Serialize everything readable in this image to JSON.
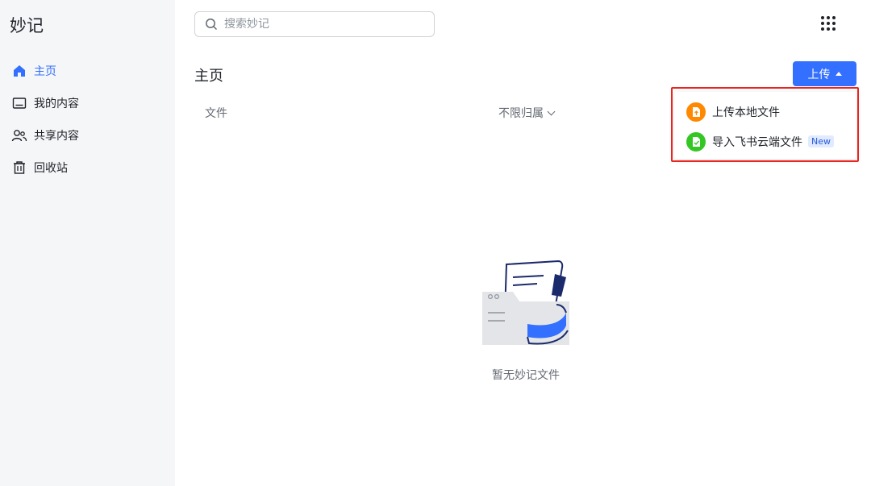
{
  "app": {
    "title": "妙记"
  },
  "sidebar": {
    "items": [
      {
        "label": "主页",
        "icon": "home-icon",
        "active": true
      },
      {
        "label": "我的内容",
        "icon": "folder-icon"
      },
      {
        "label": "共享内容",
        "icon": "users-icon"
      },
      {
        "label": "回收站",
        "icon": "trash-icon"
      }
    ]
  },
  "search": {
    "placeholder": "搜索妙记",
    "value": ""
  },
  "header": {
    "title": "主页",
    "upload_label": "上传"
  },
  "table": {
    "columns": [
      {
        "label": "文件"
      },
      {
        "label": "不限归属"
      }
    ]
  },
  "upload_menu": {
    "items": [
      {
        "label": "上传本地文件",
        "icon": "upload-file-icon",
        "color": "#ff8800"
      },
      {
        "label": "导入飞书云端文件",
        "icon": "import-cloud-file-icon",
        "color": "#34c724",
        "badge": "New"
      }
    ]
  },
  "empty_state": {
    "text": "暂无妙记文件"
  },
  "colors": {
    "accent": "#3370ff",
    "highlight": "#e8251e"
  }
}
